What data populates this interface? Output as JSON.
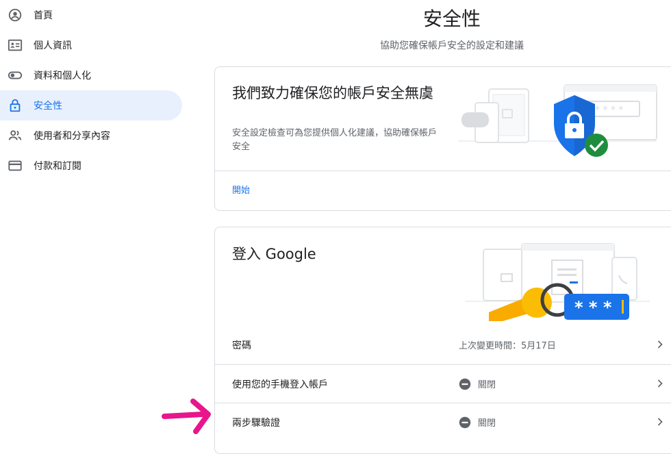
{
  "sidebar": {
    "items": [
      {
        "label": "首頁",
        "icon": "account-circle-icon"
      },
      {
        "label": "個人資訊",
        "icon": "id-card-icon"
      },
      {
        "label": "資料和個人化",
        "icon": "toggle-icon"
      },
      {
        "label": "安全性",
        "icon": "lock-icon",
        "active": true
      },
      {
        "label": "使用者和分享內容",
        "icon": "people-icon"
      },
      {
        "label": "付款和訂閱",
        "icon": "credit-card-icon"
      }
    ]
  },
  "header": {
    "title": "安全性",
    "subtitle": "協助您確保帳戶安全的設定和建議"
  },
  "security_checkup": {
    "title": "我們致力確保您的帳戶安全無虞",
    "description": "安全設定檢查可為您提供個人化建議，協助確保帳戶安全",
    "link": "開始"
  },
  "signin": {
    "title": "登入 Google",
    "rows": [
      {
        "label": "密碼",
        "value": "上次變更時間：5月17日"
      },
      {
        "label": "使用您的手機登入帳戶",
        "value": "關閉",
        "status_icon": "minus-circle-icon"
      },
      {
        "label": "兩步驟驗證",
        "value": "關閉",
        "status_icon": "minus-circle-icon"
      }
    ]
  },
  "colors": {
    "accent": "#1a73e8",
    "active_bg": "#e8f0fe",
    "annotation_arrow": "#e8158d"
  }
}
